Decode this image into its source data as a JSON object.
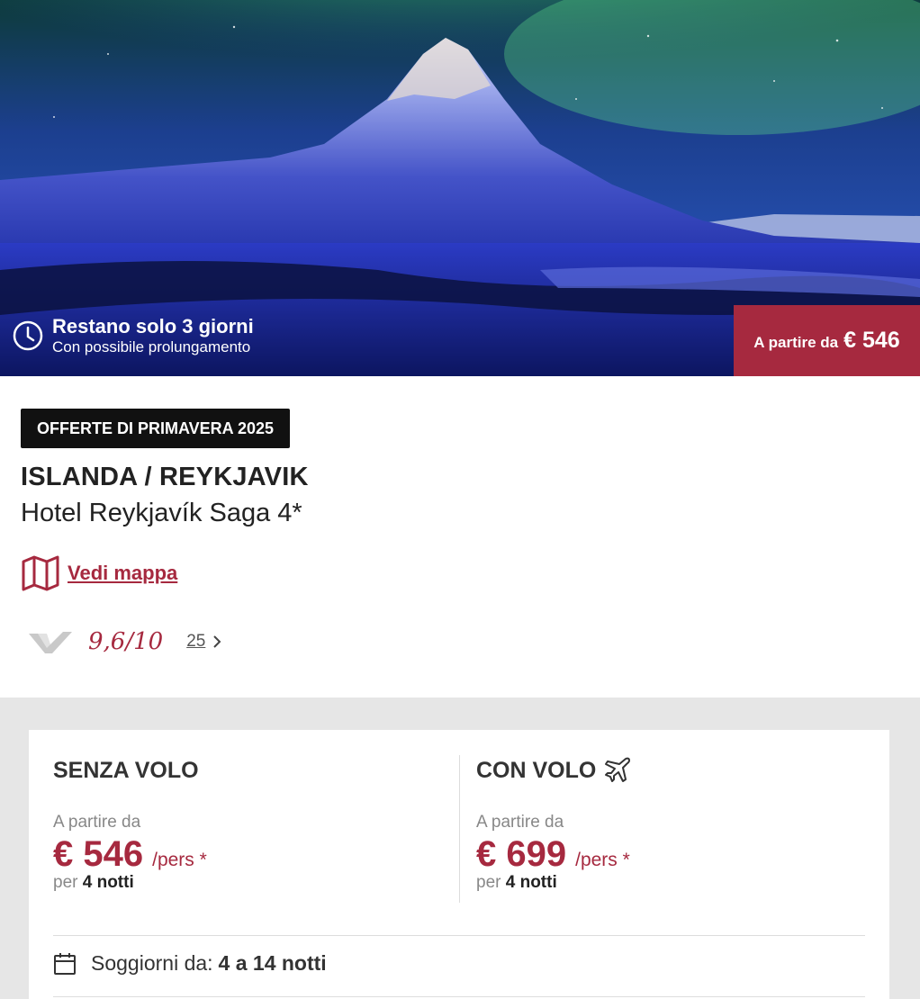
{
  "hero": {
    "countdown_title": "Restano solo 3 giorni",
    "countdown_subtitle": "Con possibile prolungamento",
    "price_label": "A partire da",
    "price_value": "€ 546"
  },
  "offer": {
    "badge": "OFFERTE DI PRIMAVERA 2025",
    "destination": "ISLANDA / REYKJAVIK",
    "hotel": "Hotel Reykjavík Saga 4*",
    "map_link": "Vedi mappa",
    "rating_score": "9,6/10",
    "review_count": "25"
  },
  "pricing": {
    "without_flight": {
      "title": "SENZA VOLO",
      "from_label": "A partire da",
      "price": "€ 546",
      "unit": "/pers *",
      "per": "per",
      "nights": "4 notti"
    },
    "with_flight": {
      "title": "CON VOLO",
      "from_label": "A partire da",
      "price": "€ 699",
      "unit": "/pers *",
      "per": "per",
      "nights": "4 notti"
    },
    "stay_label": "Soggiorni da:",
    "stay_value": "4 a 14 notti"
  },
  "icons": [
    "clock-icon",
    "map-icon",
    "rating-logo-icon",
    "chevron-right-icon",
    "airplane-icon",
    "calendar-icon"
  ],
  "colors": {
    "accent": "#a6293f",
    "badge_bg": "#111111",
    "page_bg": "#e6e6e6"
  }
}
